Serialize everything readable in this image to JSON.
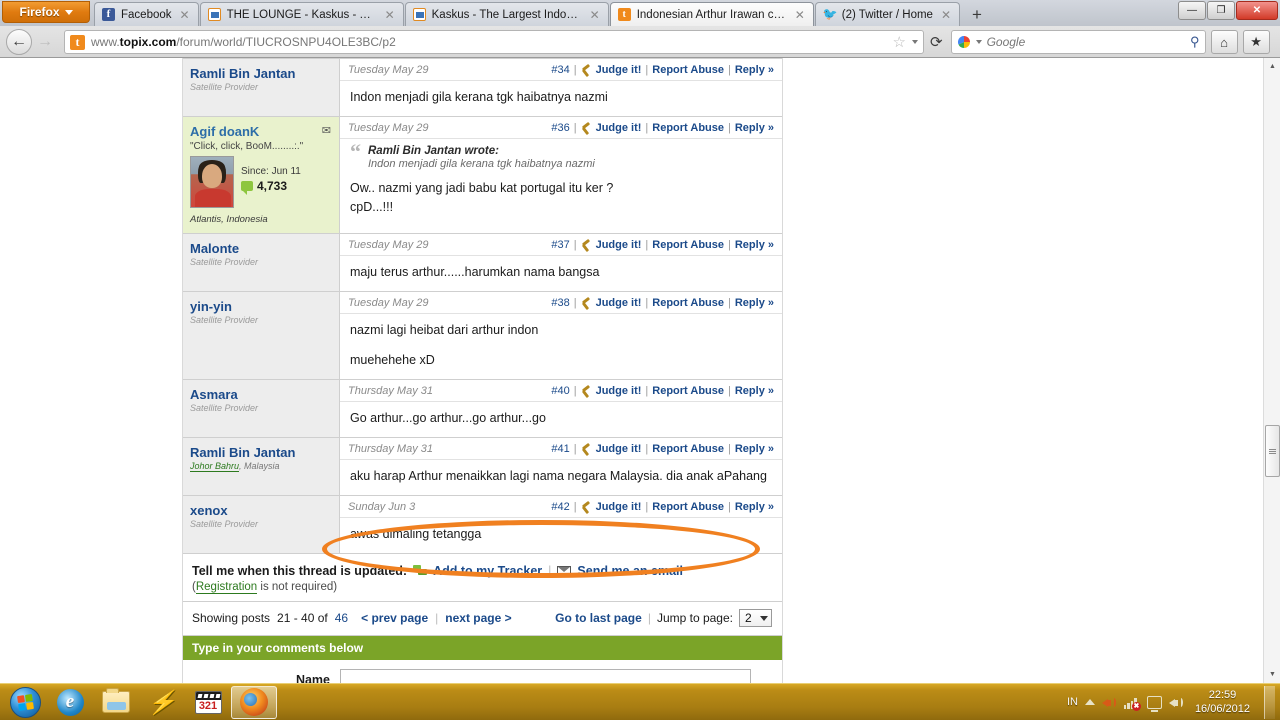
{
  "browser": {
    "app_menu_label": "Firefox",
    "tabs": [
      {
        "title": "Facebook",
        "favicon": "facebook-icon",
        "active": false
      },
      {
        "title": "THE LOUNGE - Kaskus - The La...",
        "favicon": "kaskus-icon",
        "active": false
      },
      {
        "title": "Kaskus - The Largest Indonesia...",
        "favicon": "kaskus-icon",
        "active": false
      },
      {
        "title": "Indonesian Arthur Irawan called...",
        "favicon": "topix-icon",
        "active": true
      },
      {
        "title": "(2) Twitter / Home",
        "favicon": "twitter-icon",
        "active": false
      }
    ],
    "new_tab_label": "+",
    "window_controls": {
      "minimize": "—",
      "restore": "❐",
      "close": "✕"
    },
    "back_icon": "back-arrow-icon",
    "forward_icon": "forward-arrow-icon",
    "url_prefix": "www.",
    "url_domain": "topix.com",
    "url_path": "/forum/world/TIUCROSNPU4OLE3BC/p2",
    "url_identity_letter": "t",
    "bookmark_star": "☆",
    "reload_icon": "⟳",
    "search_placeholder": "Google",
    "search_magnifier": "⚲",
    "home_icon": "⌂",
    "bookmarks_icon": "★"
  },
  "forum": {
    "posts": [
      {
        "username": "Ramli Bin Jantan",
        "user_title": "Satellite Provider",
        "date": "Tuesday May 29",
        "post_number": "#34",
        "judge_label": "Judge it!",
        "report_label": "Report Abuse",
        "reply_label": "Reply »",
        "body": [
          "Indon menjadi gila kerana tgk haibatnya nazmi"
        ],
        "highlight": false
      },
      {
        "username": "Agif doanK",
        "user_quote": "\"Click, click, BooM........:.\"",
        "since_label": "Since: Jun 11",
        "post_count": "4,733",
        "location": "Atlantis, Indonesia",
        "date": "Tuesday May 29",
        "post_number": "#36",
        "judge_label": "Judge it!",
        "report_label": "Report Abuse",
        "reply_label": "Reply »",
        "quote_author": "Ramli Bin Jantan wrote:",
        "quote_text": "Indon menjadi gila kerana tgk haibatnya nazmi",
        "body": [
          "Ow.. nazmi yang jadi babu kat portugal itu ker ?",
          "cpD...!!!"
        ],
        "highlight": true
      },
      {
        "username": "Malonte",
        "user_title": "Satellite Provider",
        "date": "Tuesday May 29",
        "post_number": "#37",
        "judge_label": "Judge it!",
        "report_label": "Report Abuse",
        "reply_label": "Reply »",
        "body": [
          "maju terus arthur......harumkan nama bangsa"
        ],
        "highlight": false
      },
      {
        "username": "yin-yin",
        "user_title": "Satellite Provider",
        "date": "Tuesday May 29",
        "post_number": "#38",
        "judge_label": "Judge it!",
        "report_label": "Report Abuse",
        "reply_label": "Reply »",
        "body": [
          "nazmi lagi heibat dari arthur indon",
          "muehehehe xD"
        ],
        "highlight": false
      },
      {
        "username": "Asmara",
        "user_title": "Satellite Provider",
        "date": "Thursday May 31",
        "post_number": "#40",
        "judge_label": "Judge it!",
        "report_label": "Report Abuse",
        "reply_label": "Reply »",
        "body": [
          "Go arthur...go arthur...go arthur...go"
        ],
        "highlight": false
      },
      {
        "username": "Ramli Bin Jantan",
        "user_city": "Johor Bahru",
        "user_country": ", Malaysia",
        "date": "Thursday May 31",
        "post_number": "#41",
        "judge_label": "Judge it!",
        "report_label": "Report Abuse",
        "reply_label": "Reply »",
        "body": [
          "aku harap Arthur menaikkan lagi nama negara Malaysia. dia anak aPahang"
        ],
        "highlight": false,
        "annotated": true
      },
      {
        "username": "xenox",
        "user_title": "Satellite Provider",
        "date": "Sunday Jun 3",
        "post_number": "#42",
        "judge_label": "Judge it!",
        "report_label": "Report Abuse",
        "reply_label": "Reply »",
        "body": [
          "awas dimaling tetangga"
        ],
        "highlight": false
      }
    ],
    "tracker": {
      "label": "Tell me when this thread is updated:",
      "add_tracker": "Add to my Tracker",
      "send_email": "Send me an email",
      "registration_link": "Registration",
      "registration_rest": " is not required)",
      "registration_open": "("
    },
    "pager": {
      "showing_label": "Showing posts",
      "range": "21 - 40 of",
      "total": "46",
      "prev": "< prev page",
      "next": "next page >",
      "last": "Go to last page",
      "jump_label": "Jump to page:",
      "jump_value": "2"
    },
    "comment_form": {
      "header": "Type in your comments below",
      "name_label": "Name",
      "name_value": ""
    }
  },
  "annotation": {
    "shape": "ellipse",
    "color": "#f08020"
  },
  "taskbar": {
    "start_label": "start-orb",
    "items": [
      {
        "name": "internet-explorer",
        "active": false
      },
      {
        "name": "file-explorer",
        "active": false
      },
      {
        "name": "winamp",
        "active": false
      },
      {
        "name": "media-player-classic",
        "active": false
      },
      {
        "name": "firefox",
        "active": true
      }
    ],
    "tray": {
      "language": "IN",
      "time": "22:59",
      "date": "16/06/2012"
    }
  }
}
